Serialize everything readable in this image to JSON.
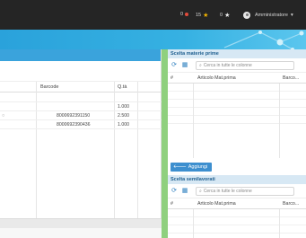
{
  "topbar": {
    "badge_red": "0",
    "badge_star": "15",
    "badge_dark": "0",
    "user_name": "Amministratore",
    "colors": {
      "red": "#e24b3b",
      "star": "#f3b400",
      "dark": "#9a9a9a"
    }
  },
  "left_table": {
    "columns": [
      "Barcode",
      "Q.tà"
    ],
    "rows": [
      {
        "barcode": "",
        "qty": "1.000"
      },
      {
        "barcode": "8000692391150",
        "qty": "2.500"
      },
      {
        "barcode": "8000692390436",
        "qty": "1.000"
      }
    ]
  },
  "materie_prime": {
    "title": "Scelta materie prime",
    "search_placeholder": "Cerca in tutte le colonne",
    "columns": [
      "#",
      "Articolo Mat.prima",
      "Barco..."
    ]
  },
  "add_button": {
    "label": "Aggiungi"
  },
  "semilavorati": {
    "title": "Scelta semilavorati",
    "search_placeholder": "Cerca in tutte le colonne",
    "columns": [
      "#",
      "Articolo Mat.prima",
      "Barco..."
    ]
  }
}
